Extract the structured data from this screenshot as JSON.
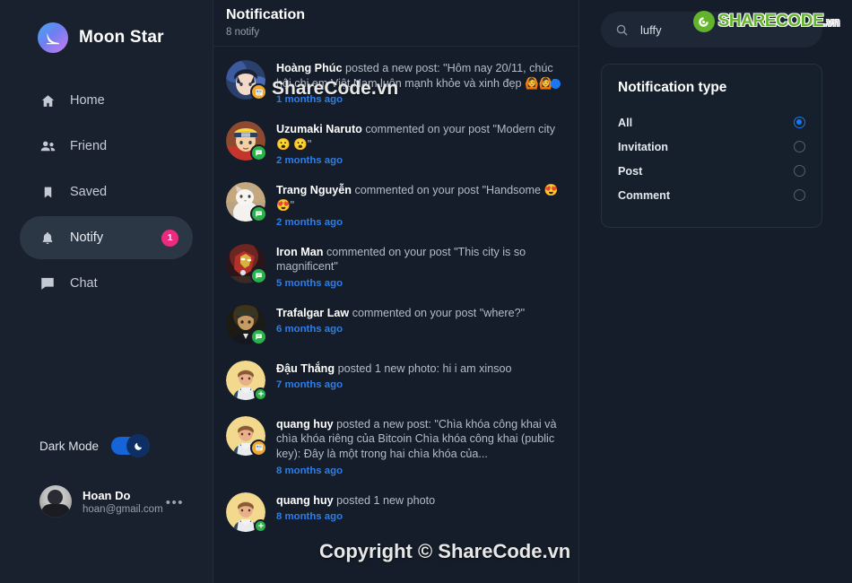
{
  "brand": {
    "name": "Moon Star",
    "logo_icon": "crescent-moon-icon"
  },
  "sidebar": {
    "items": [
      {
        "label": "Home",
        "icon": "home-icon",
        "active": false,
        "badge": ""
      },
      {
        "label": "Friend",
        "icon": "friends-icon",
        "active": false,
        "badge": ""
      },
      {
        "label": "Saved",
        "icon": "bookmark-icon",
        "active": false,
        "badge": ""
      },
      {
        "label": "Notify",
        "icon": "bell-icon",
        "active": true,
        "badge": "1"
      },
      {
        "label": "Chat",
        "icon": "chat-icon",
        "active": false,
        "badge": ""
      }
    ],
    "dark_mode": {
      "label": "Dark Mode",
      "enabled": true,
      "knob_icon": "moon-icon"
    },
    "profile": {
      "name": "Hoan Do",
      "email": "hoan@gmail.com",
      "more_icon": "ellipsis-icon"
    }
  },
  "notifications_panel": {
    "title": "Notification",
    "subtitle": "8 notify",
    "items": [
      {
        "user": "Hoàng Phúc",
        "action": " posted a new post: \"Hôm nay 20/11, chúc hội chị em Việt Nam luôn mạnh khỏe và xinh đẹp 🙆🙆\"",
        "time": "1 months ago",
        "badge_type": "post",
        "unread": true,
        "avatar_kind": "anime-boy"
      },
      {
        "user": "Uzumaki Naruto",
        "action": " commented on your post \"Modern city 😮 😮\"",
        "time": "2 months ago",
        "badge_type": "comment",
        "unread": false,
        "avatar_kind": "naruto"
      },
      {
        "user": "Trang Nguyễn",
        "action": " commented on your post \"Handsome 😍😍\"",
        "time": "2 months ago",
        "badge_type": "comment",
        "unread": false,
        "avatar_kind": "cat"
      },
      {
        "user": "Iron Man",
        "action": " commented on your post \"This city is so magnificent\"",
        "time": "5 months ago",
        "badge_type": "comment",
        "unread": false,
        "avatar_kind": "ironman"
      },
      {
        "user": "Trafalgar Law",
        "action": " commented on your post \"where?\"",
        "time": "6 months ago",
        "badge_type": "comment",
        "unread": false,
        "avatar_kind": "law"
      },
      {
        "user": "Đậu Thắng",
        "action": " posted 1 new photo: hi i am xinsoo",
        "time": "7 months ago",
        "badge_type": "photo",
        "unread": false,
        "avatar_kind": "default-person"
      },
      {
        "user": "quang huy",
        "action": " posted a new post: \"Chìa khóa công khai và chìa khóa riêng của Bitcoin Chìa khóa công khai (public key): Đây là một trong hai chìa khóa của...",
        "time": "8 months ago",
        "badge_type": "post",
        "unread": false,
        "avatar_kind": "default-person"
      },
      {
        "user": "quang huy",
        "action": " posted 1 new photo",
        "time": "8 months ago",
        "badge_type": "photo",
        "unread": false,
        "avatar_kind": "default-person"
      }
    ]
  },
  "search": {
    "value": "luffy",
    "placeholder": "Search",
    "icon": "search-icon"
  },
  "notification_type": {
    "title": "Notification type",
    "options": [
      {
        "label": "All",
        "selected": true
      },
      {
        "label": "Invitation",
        "selected": false
      },
      {
        "label": "Post",
        "selected": false
      },
      {
        "label": "Comment",
        "selected": false
      }
    ]
  },
  "watermarks": {
    "center": "ShareCode.vn",
    "copyright": "Copyright © ShareCode.vn",
    "logo_text": "SHARECODE",
    "logo_suffix": ".vn"
  },
  "colors": {
    "background": "#141d29",
    "sidebar": "#19212e",
    "accent_blue": "#1877f2",
    "badge_pink": "#ec2a7e",
    "time_blue": "#2e7ee8",
    "comment_green": "#2bb14a",
    "post_orange": "#f0a92e"
  }
}
